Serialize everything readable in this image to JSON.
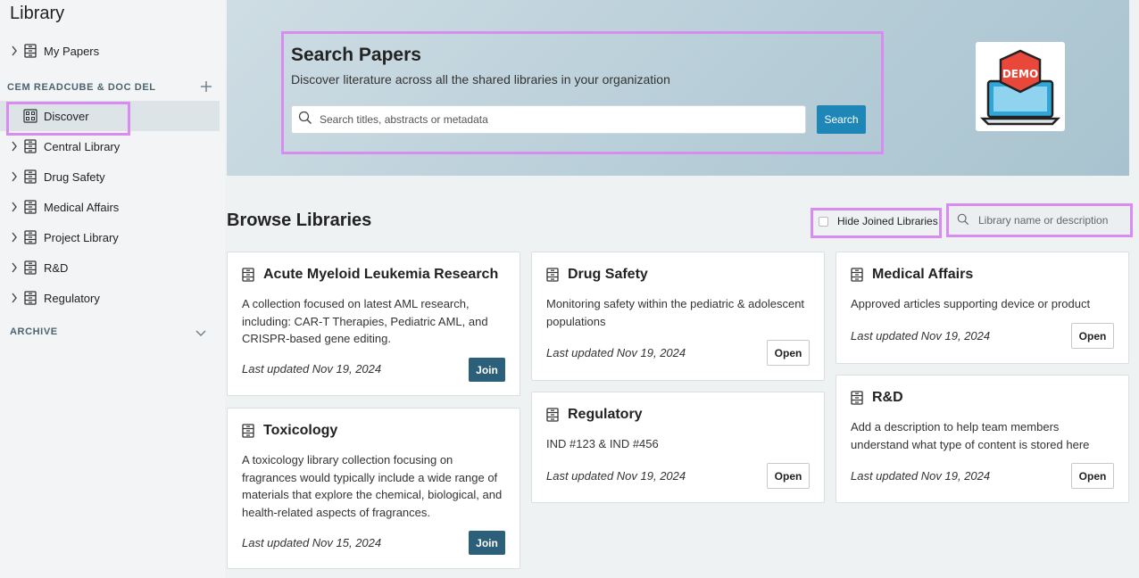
{
  "sidebar": {
    "title": "Library",
    "my_papers": "My Papers",
    "section_label": "CEM READCUBE & DOC DEL",
    "items": [
      {
        "label": "Discover"
      },
      {
        "label": "Central Library"
      },
      {
        "label": "Drug Safety"
      },
      {
        "label": "Medical Affairs"
      },
      {
        "label": "Project Library"
      },
      {
        "label": "R&D"
      },
      {
        "label": "Regulatory"
      }
    ],
    "archive_label": "ARCHIVE"
  },
  "hero": {
    "title": "Search Papers",
    "subtitle": "Discover literature across all the shared libraries in your organization",
    "search_placeholder": "Search titles, abstracts or metadata",
    "search_button": "Search",
    "logo_text": "DEMO"
  },
  "browse": {
    "title": "Browse Libraries",
    "hide_joined_label": "Hide Joined Libraries",
    "search_placeholder": "Library name or description"
  },
  "cards": [
    {
      "title": "Acute Myeloid Leukemia Research",
      "desc": "A collection focused on latest AML research, including: CAR-T Therapies, Pediatric AML, and CRISPR-based gene editing.",
      "date": "Last updated Nov 19, 2024",
      "action": "Join"
    },
    {
      "title": "Toxicology",
      "desc": "A toxicology library collection focusing on fragrances would typically include a wide range of materials that explore the chemical, biological, and health-related aspects of fragrances.",
      "date": "Last updated Nov 15, 2024",
      "action": "Join"
    },
    {
      "title": "Drug Safety",
      "desc": "Monitoring safety within the pediatric & adolescent populations",
      "date": "Last updated Nov 19, 2024",
      "action": "Open"
    },
    {
      "title": "Regulatory",
      "desc": "IND #123 & IND #456",
      "date": "Last updated Nov 19, 2024",
      "action": "Open"
    },
    {
      "title": "Medical Affairs",
      "desc": "Approved articles supporting device or product",
      "date": "Last updated Nov 19, 2024",
      "action": "Open"
    },
    {
      "title": "R&D",
      "desc": "Add a description to help team members understand what type of content is stored here",
      "date": "Last updated Nov 19, 2024",
      "action": "Open"
    }
  ],
  "colors": {
    "accent": "#1f86b8",
    "join_button": "#2b5f7a",
    "highlight": "#d98cf0",
    "logo_red": "#e8473a",
    "logo_blue": "#2fa6d8"
  },
  "icons": {
    "library": "library-icon",
    "discover": "discover-icon",
    "search": "search-icon",
    "plus": "plus-icon",
    "chevron_right": "chevron-right-icon",
    "chevron_down": "chevron-down-icon"
  }
}
